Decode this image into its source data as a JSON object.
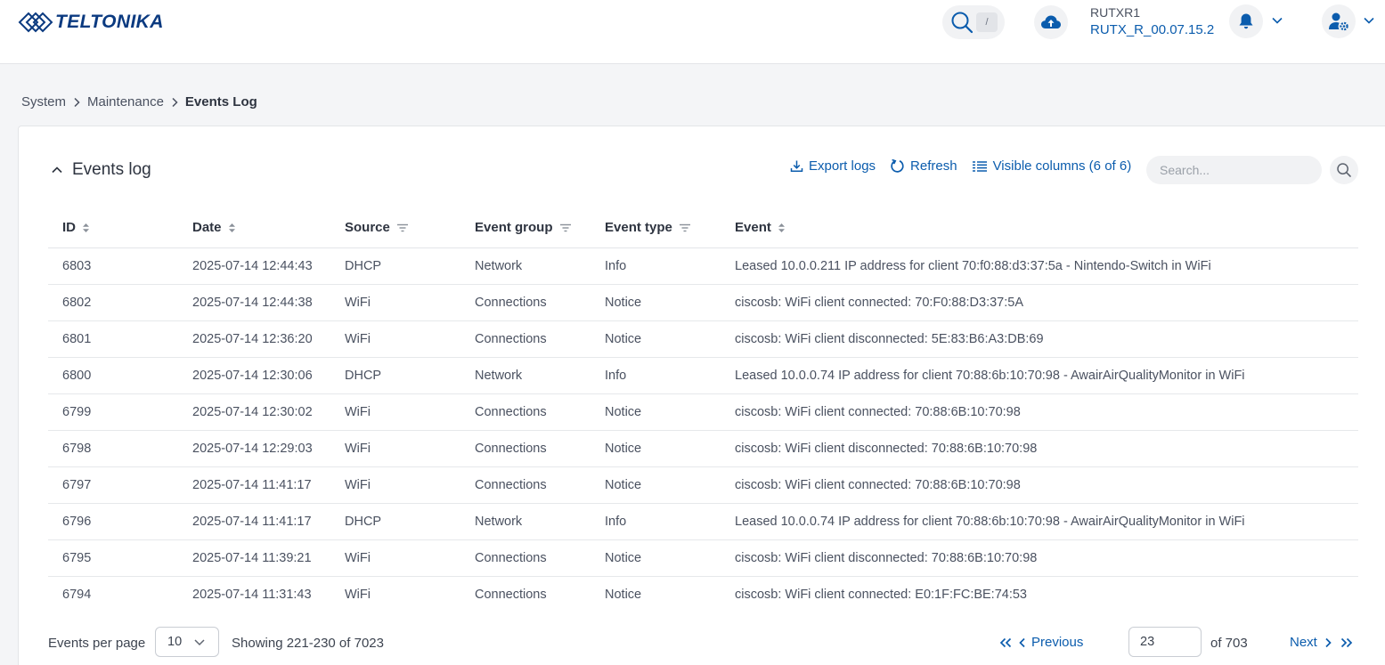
{
  "header": {
    "logo_text": "TELTONIKA",
    "search_shortcut": "/",
    "device_name": "RUTXR1",
    "firmware": "RUTX_R_00.07.15.2"
  },
  "breadcrumb": [
    "System",
    "Maintenance",
    "Events Log"
  ],
  "card": {
    "title": "Events log",
    "export_label": "Export logs",
    "refresh_label": "Refresh",
    "columns_label": "Visible columns (6 of 6)",
    "search_placeholder": "Search..."
  },
  "table": {
    "headers": [
      "ID",
      "Date",
      "Source",
      "Event group",
      "Event type",
      "Event"
    ],
    "rows": [
      [
        "6803",
        "2025-07-14 12:44:43",
        "DHCP",
        "Network",
        "Info",
        "Leased 10.0.0.211 IP address for client 70:f0:88:d3:37:5a - Nintendo-Switch in WiFi"
      ],
      [
        "6802",
        "2025-07-14 12:44:38",
        "WiFi",
        "Connections",
        "Notice",
        "ciscosb: WiFi client connected: 70:F0:88:D3:37:5A"
      ],
      [
        "6801",
        "2025-07-14 12:36:20",
        "WiFi",
        "Connections",
        "Notice",
        "ciscosb: WiFi client disconnected: 5E:83:B6:A3:DB:69"
      ],
      [
        "6800",
        "2025-07-14 12:30:06",
        "DHCP",
        "Network",
        "Info",
        "Leased 10.0.0.74 IP address for client 70:88:6b:10:70:98 - AwairAirQualityMonitor in WiFi"
      ],
      [
        "6799",
        "2025-07-14 12:30:02",
        "WiFi",
        "Connections",
        "Notice",
        "ciscosb: WiFi client connected: 70:88:6B:10:70:98"
      ],
      [
        "6798",
        "2025-07-14 12:29:03",
        "WiFi",
        "Connections",
        "Notice",
        "ciscosb: WiFi client disconnected: 70:88:6B:10:70:98"
      ],
      [
        "6797",
        "2025-07-14 11:41:17",
        "WiFi",
        "Connections",
        "Notice",
        "ciscosb: WiFi client connected: 70:88:6B:10:70:98"
      ],
      [
        "6796",
        "2025-07-14 11:41:17",
        "DHCP",
        "Network",
        "Info",
        "Leased 10.0.0.74 IP address for client 70:88:6b:10:70:98 - AwairAirQualityMonitor in WiFi"
      ],
      [
        "6795",
        "2025-07-14 11:39:21",
        "WiFi",
        "Connections",
        "Notice",
        "ciscosb: WiFi client disconnected: 70:88:6B:10:70:98"
      ],
      [
        "6794",
        "2025-07-14 11:31:43",
        "WiFi",
        "Connections",
        "Notice",
        "ciscosb: WiFi client connected: E0:1F:FC:BE:74:53"
      ]
    ]
  },
  "footer": {
    "per_page_label": "Events per page",
    "per_page_value": "10",
    "showing": "Showing 221-230 of 7023",
    "previous_label": "Previous",
    "page_value": "23",
    "of_pages": "of 703",
    "next_label": "Next"
  },
  "colors": {
    "accent": "#0b5cad",
    "logo": "#0b3a80"
  }
}
